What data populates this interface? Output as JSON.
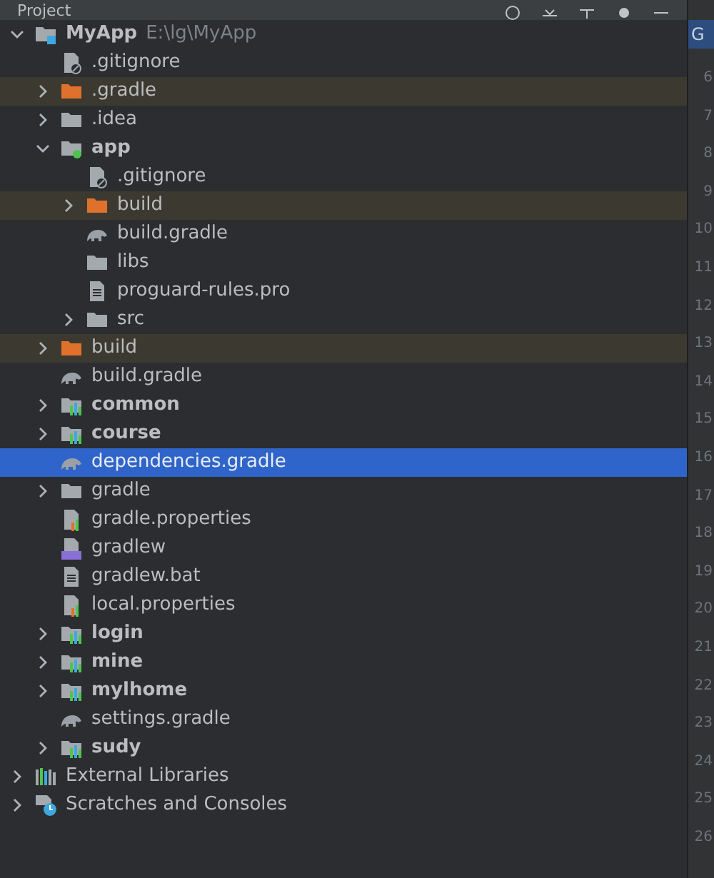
{
  "panel": {
    "title": "Project"
  },
  "tree": [
    {
      "name": "MyApp",
      "path": "E:\\lg\\MyApp",
      "kind": "root",
      "bold": true,
      "expanded": true,
      "children": [
        {
          "name": ".gitignore",
          "kind": "ignore"
        },
        {
          "name": ".gradle",
          "kind": "folder",
          "excluded": true,
          "expanded": false
        },
        {
          "name": ".idea",
          "kind": "folder",
          "expanded": false
        },
        {
          "name": "app",
          "kind": "module-dot",
          "bold": true,
          "expanded": true,
          "children": [
            {
              "name": ".gitignore",
              "kind": "ignore"
            },
            {
              "name": "build",
              "kind": "folder",
              "excluded": true,
              "expanded": false
            },
            {
              "name": "build.gradle",
              "kind": "gradle"
            },
            {
              "name": "libs",
              "kind": "folder"
            },
            {
              "name": "proguard-rules.pro",
              "kind": "text"
            },
            {
              "name": "src",
              "kind": "folder",
              "expanded": false
            }
          ]
        },
        {
          "name": "build",
          "kind": "folder",
          "excluded": true,
          "expanded": false
        },
        {
          "name": "build.gradle",
          "kind": "gradle"
        },
        {
          "name": "common",
          "kind": "module",
          "bold": true,
          "expanded": false
        },
        {
          "name": "course",
          "kind": "module",
          "bold": true,
          "expanded": false
        },
        {
          "name": "dependencies.gradle",
          "kind": "gradle",
          "selected": true
        },
        {
          "name": "gradle",
          "kind": "folder",
          "expanded": false
        },
        {
          "name": "gradle.properties",
          "kind": "properties"
        },
        {
          "name": "gradlew",
          "kind": "script"
        },
        {
          "name": "gradlew.bat",
          "kind": "text"
        },
        {
          "name": "local.properties",
          "kind": "properties"
        },
        {
          "name": "login",
          "kind": "module",
          "bold": true,
          "expanded": false
        },
        {
          "name": "mine",
          "kind": "module",
          "bold": true,
          "expanded": false
        },
        {
          "name": "mylhome",
          "kind": "module",
          "bold": true,
          "expanded": false
        },
        {
          "name": "settings.gradle",
          "kind": "gradle"
        },
        {
          "name": "sudy",
          "kind": "module",
          "bold": true,
          "expanded": false
        }
      ]
    },
    {
      "name": "External Libraries",
      "kind": "libraries",
      "expanded": false
    },
    {
      "name": "Scratches and Consoles",
      "kind": "scratches",
      "expanded": false
    }
  ],
  "editor": {
    "tab": "G",
    "line_numbers": [
      "6",
      "7",
      "8",
      "9",
      "10",
      "11",
      "12",
      "13",
      "14",
      "15",
      "16",
      "17",
      "18",
      "19",
      "20",
      "21",
      "22",
      "23",
      "24",
      "25",
      "26"
    ]
  }
}
